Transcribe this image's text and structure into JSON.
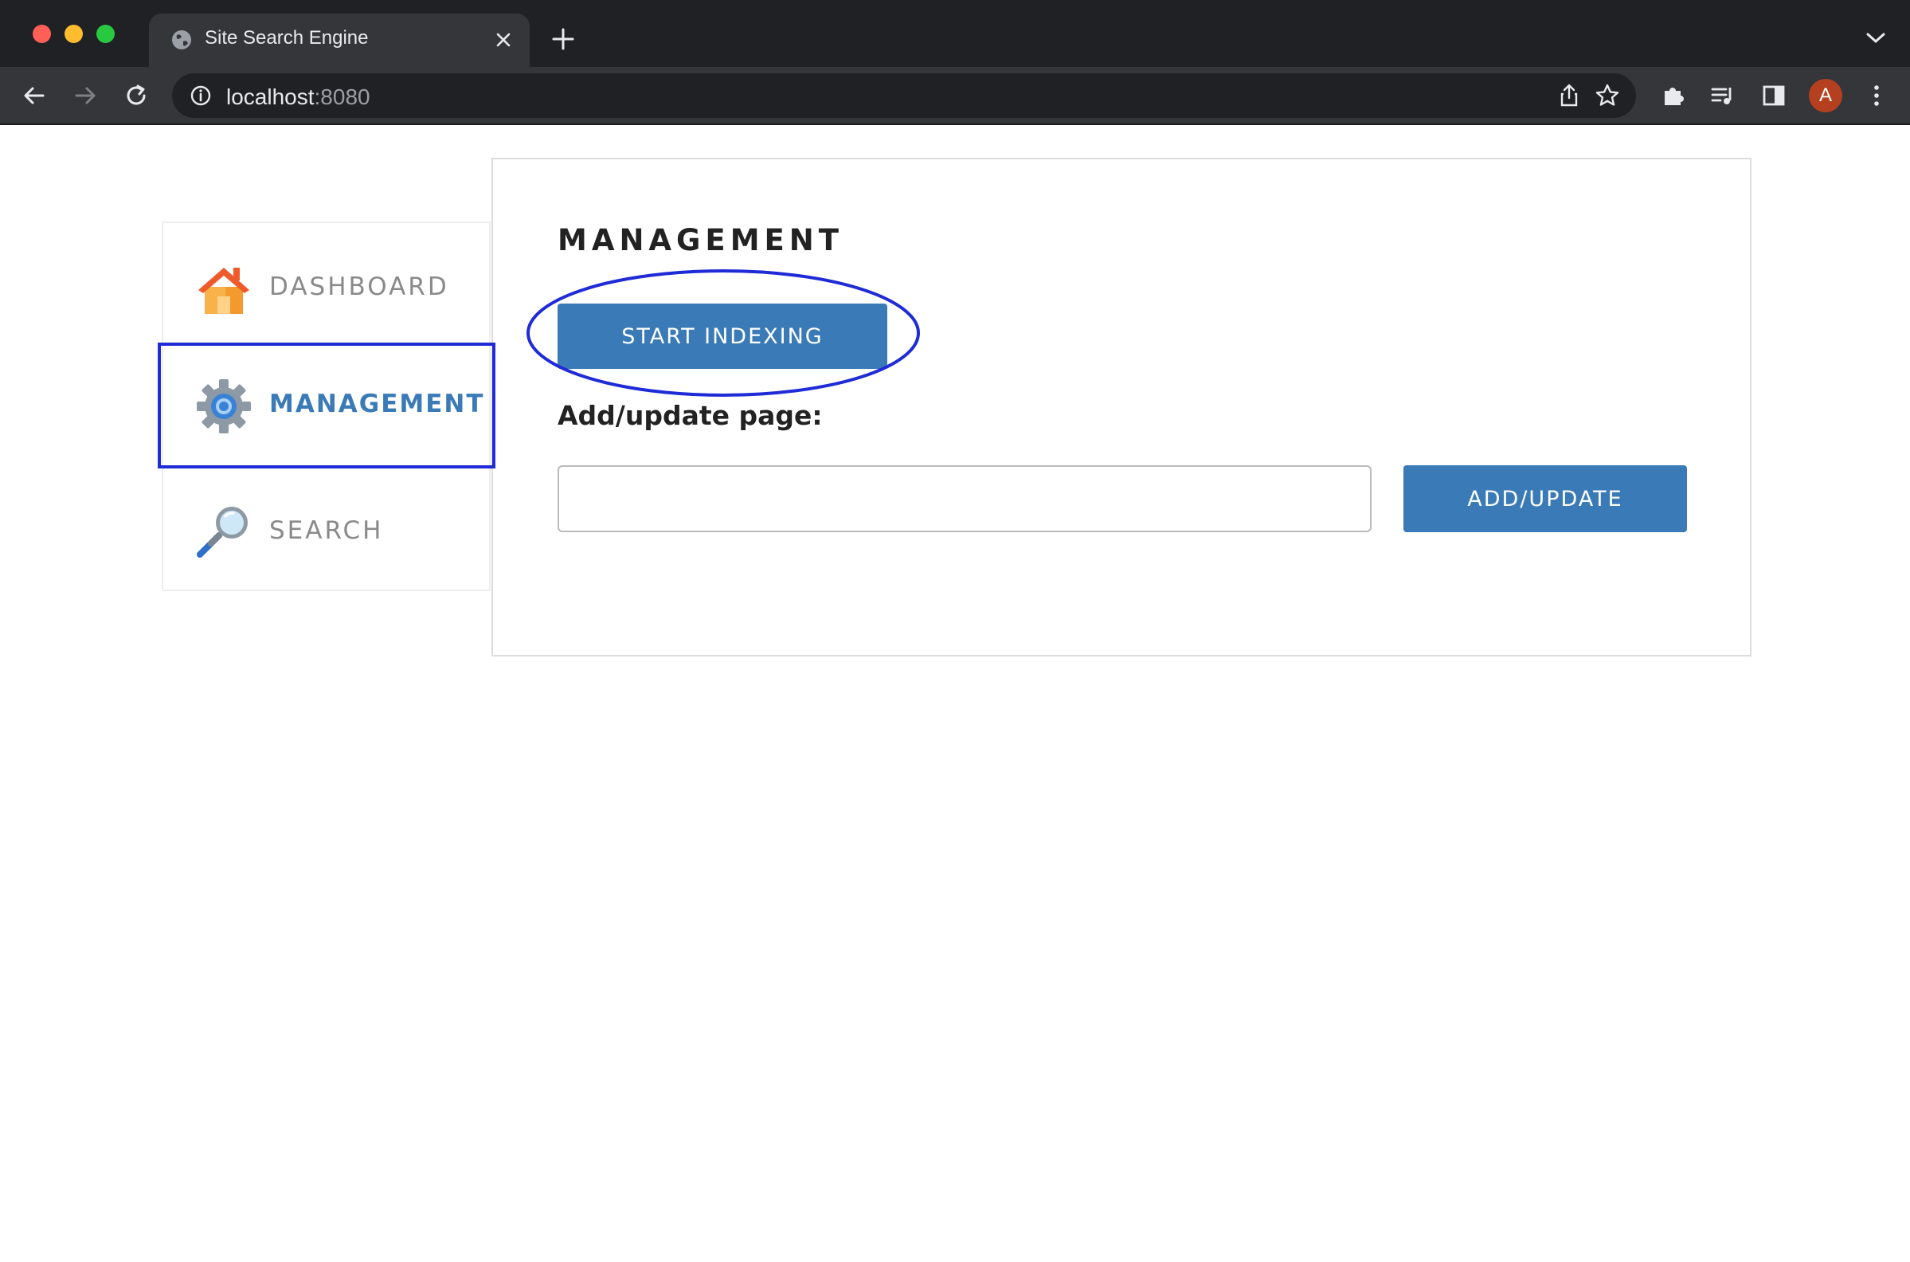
{
  "browser": {
    "tab_title": "Site Search Engine",
    "url_host": "localhost",
    "url_port": ":8080",
    "profile_initial": "A",
    "icons": [
      "globe-icon",
      "close-icon",
      "plus-icon",
      "chevron-down-icon",
      "back-arrow-icon",
      "forward-arrow-icon",
      "reload-icon",
      "info-icon",
      "share-icon",
      "star-icon",
      "puzzle-icon",
      "media-icon",
      "side-panel-icon",
      "kebab-menu-icon"
    ]
  },
  "sidebar": {
    "items": [
      {
        "label": "DASHBOARD",
        "icon": "house-icon",
        "active": false
      },
      {
        "label": "MANAGEMENT",
        "icon": "gear-icon",
        "active": true
      },
      {
        "label": "SEARCH",
        "icon": "magnifier-icon",
        "active": false
      }
    ]
  },
  "main": {
    "title": "MANAGEMENT",
    "start_button": "START INDEXING",
    "add_label": "Add/update page:",
    "add_input_value": "",
    "add_button": "ADD/UPDATE"
  },
  "colors": {
    "accent": "#3a7bb7",
    "annotation": "#1f2bd6",
    "chrome_dark": "#202124",
    "chrome_toolbar": "#35363a"
  }
}
